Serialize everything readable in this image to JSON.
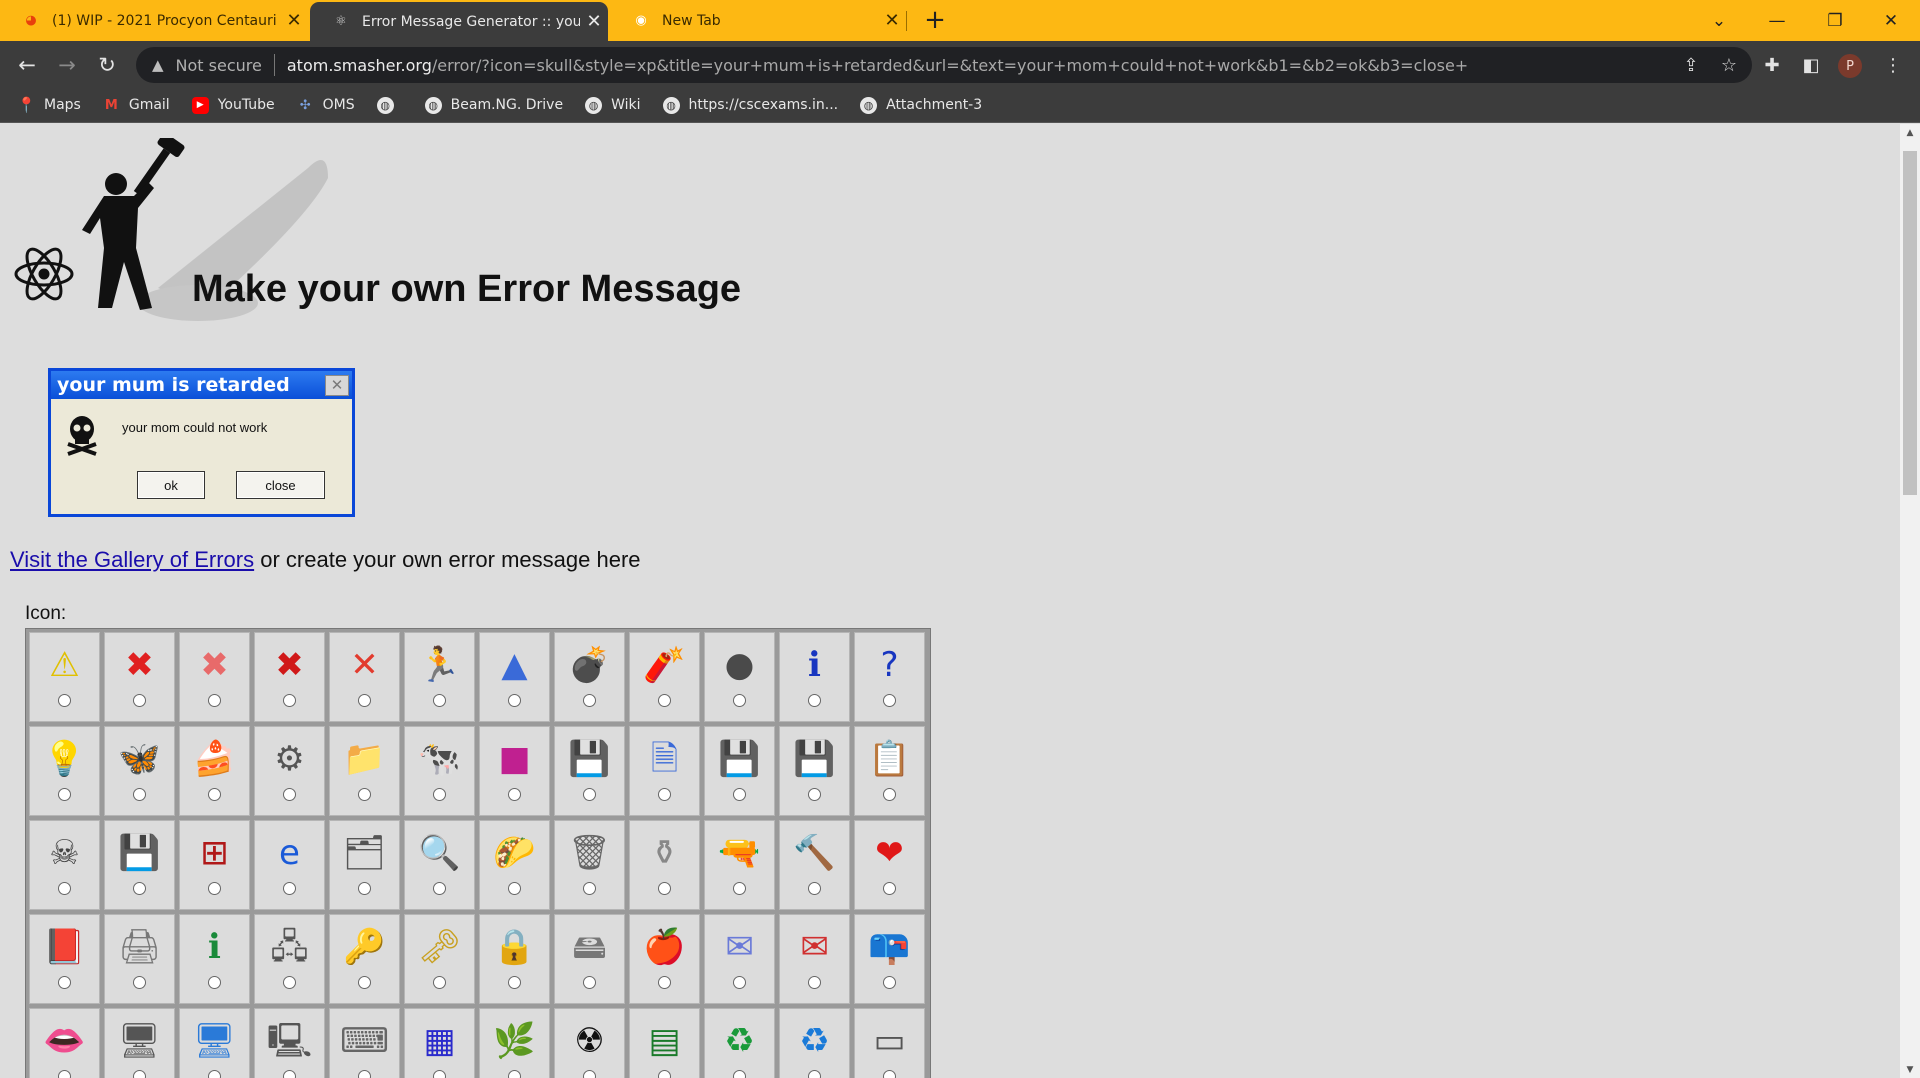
{
  "browser": {
    "tabs": [
      {
        "title": "(1) WIP - 2021 Procyon Centauri",
        "favicon": "reddit-icon",
        "active": false
      },
      {
        "title": "Error Message Generator :: your n",
        "favicon": "atom-smasher-icon",
        "active": true
      },
      {
        "title": "New Tab",
        "favicon": "chrome-icon",
        "active": false
      }
    ],
    "address": {
      "security_label": "Not secure",
      "host": "atom.smasher.org",
      "path": "/error/?icon=skull&style=xp&title=your+mum+is+retarded&url=&text=your+mom+could+not+work&b1=&b2=ok&b3=close+"
    },
    "profile_initial": "P",
    "bookmarks": [
      {
        "label": "Maps",
        "icon": "maps-icon"
      },
      {
        "label": "Gmail",
        "icon": "gmail-icon"
      },
      {
        "label": "YouTube",
        "icon": "youtube-icon"
      },
      {
        "label": "OMS",
        "icon": "oms-icon"
      },
      {
        "label": "",
        "icon": "globe-icon"
      },
      {
        "label": "Beam.NG. Drive",
        "icon": "globe-icon"
      },
      {
        "label": "Wiki",
        "icon": "globe-icon"
      },
      {
        "label": "https://cscexams.in...",
        "icon": "globe-icon"
      },
      {
        "label": "Attachment-3",
        "icon": "globe-icon"
      }
    ]
  },
  "page": {
    "heading": "Make your own Error Message",
    "dialog": {
      "title": "your mum is retarded",
      "text": "your mom could not work",
      "icon": "skull-icon",
      "buttons": [
        "ok",
        "close"
      ]
    },
    "gallery_link": "Visit the Gallery of Errors",
    "gallery_suffix": " or create your own error message here",
    "icon_section_label": "Icon:",
    "icons": [
      {
        "name": "warning-icon",
        "glyph": "⚠",
        "color": "#e0c000"
      },
      {
        "name": "error-red-circle-icon",
        "glyph": "✖",
        "color": "#e02020"
      },
      {
        "name": "error-pink-circle-icon",
        "glyph": "✖",
        "color": "#e86a6a"
      },
      {
        "name": "error-xp-circle-icon",
        "glyph": "✖",
        "color": "#d01818"
      },
      {
        "name": "red-x-icon",
        "glyph": "✕",
        "color": "#e23b2e"
      },
      {
        "name": "running-man-icon",
        "glyph": "🏃",
        "color": "#1e5fd8"
      },
      {
        "name": "blue-triangle-icon",
        "glyph": "▲",
        "color": "#3a6ad8"
      },
      {
        "name": "bomb-icon",
        "glyph": "💣",
        "color": "#333333"
      },
      {
        "name": "dynamite-icon",
        "glyph": "🧨",
        "color": "#c02020"
      },
      {
        "name": "grenade-icon",
        "glyph": "●",
        "color": "#4a4a4a"
      },
      {
        "name": "info-bubble-icon",
        "glyph": "ℹ",
        "color": "#1836c0"
      },
      {
        "name": "question-bubble-icon",
        "glyph": "?",
        "color": "#1836c0"
      },
      {
        "name": "lightbulb-icon",
        "glyph": "💡",
        "color": "#bbbbbb"
      },
      {
        "name": "windows-butterfly-icon",
        "glyph": "🦋",
        "color": "#e87a1a"
      },
      {
        "name": "cake-icon",
        "glyph": "🍰",
        "color": "#d84a8a"
      },
      {
        "name": "robot-dog-icon",
        "glyph": "⚙",
        "color": "#555555"
      },
      {
        "name": "folder-icon",
        "glyph": "📁",
        "color": "#e0c040"
      },
      {
        "name": "cow-icon",
        "glyph": "🐄",
        "color": "#333333"
      },
      {
        "name": "color-cube-icon",
        "glyph": "■",
        "color": "#c02090"
      },
      {
        "name": "floppy-blue-icon",
        "glyph": "💾",
        "color": "#2a2acc"
      },
      {
        "name": "floppy-document-icon",
        "glyph": "🗎",
        "color": "#3a6ad8"
      },
      {
        "name": "floppy-orange-icon",
        "glyph": "💾",
        "color": "#f08a10"
      },
      {
        "name": "floppy-red-icon",
        "glyph": "💾",
        "color": "#cc1818"
      },
      {
        "name": "notepad-icon",
        "glyph": "📋",
        "color": "#c89a6a"
      },
      {
        "name": "floppy-skull-icon",
        "glyph": "☠",
        "color": "#444444"
      },
      {
        "name": "floppy-yellow-icon",
        "glyph": "💾",
        "color": "#f0e020"
      },
      {
        "name": "msdos-icon",
        "glyph": "⊞",
        "color": "#b01818"
      },
      {
        "name": "internet-explorer-icon",
        "glyph": "e",
        "color": "#1a5ad8"
      },
      {
        "name": "files-stack-icon",
        "glyph": "🗂",
        "color": "#555555"
      },
      {
        "name": "magnifier-document-icon",
        "glyph": "🔍",
        "color": "#3a6ad8"
      },
      {
        "name": "taco-icon",
        "glyph": "🌮",
        "color": "#e0b020"
      },
      {
        "name": "trash-can-icon",
        "glyph": "🗑",
        "color": "#666666"
      },
      {
        "name": "urn-icon",
        "glyph": "⚱",
        "color": "#888888"
      },
      {
        "name": "revolver-icon",
        "glyph": "🔫",
        "color": "#555555"
      },
      {
        "name": "hammer-icon",
        "glyph": "🔨",
        "color": "#555555"
      },
      {
        "name": "heart-icon",
        "glyph": "❤",
        "color": "#e01818"
      },
      {
        "name": "purple-book-icon",
        "glyph": "📕",
        "color": "#9a2ab0"
      },
      {
        "name": "scanner-icon",
        "glyph": "🖨",
        "color": "#777777"
      },
      {
        "name": "info-circuit-icon",
        "glyph": "ℹ",
        "color": "#1a8a3a"
      },
      {
        "name": "network-computer-icon",
        "glyph": "🖧",
        "color": "#555555"
      },
      {
        "name": "keys-icon",
        "glyph": "🔑",
        "color": "#c8a020"
      },
      {
        "name": "key-diamond-icon",
        "glyph": "🗝",
        "color": "#c8a020"
      },
      {
        "name": "padlock-icon",
        "glyph": "🔒",
        "color": "#8a6a30"
      },
      {
        "name": "drive-icon",
        "glyph": "🖴",
        "color": "#777777"
      },
      {
        "name": "apple-icon",
        "glyph": "🍎",
        "color": "#3aa0e0"
      },
      {
        "name": "envelope-icon",
        "glyph": "✉",
        "color": "#6a7ad8"
      },
      {
        "name": "envelope-error-icon",
        "glyph": "✉",
        "color": "#d03030"
      },
      {
        "name": "mailbox-icon",
        "glyph": "📪",
        "color": "#555555"
      },
      {
        "name": "lips-icon",
        "glyph": "👄",
        "color": "#d01818"
      },
      {
        "name": "computer-icon",
        "glyph": "🖥",
        "color": "#555555"
      },
      {
        "name": "monitor-icon",
        "glyph": "🖥",
        "color": "#2a7ad8"
      },
      {
        "name": "old-computer-icon",
        "glyph": "🖳",
        "color": "#555555"
      },
      {
        "name": "keyboard-icon",
        "glyph": "⌨",
        "color": "#666666"
      },
      {
        "name": "network-card-icon",
        "glyph": "▦",
        "color": "#2a2acc"
      },
      {
        "name": "cannabis-leaf-icon",
        "glyph": "🌿",
        "color": "#1a9a2a"
      },
      {
        "name": "radiation-icon",
        "glyph": "☢",
        "color": "#111111"
      },
      {
        "name": "memory-stick-icon",
        "glyph": "▤",
        "color": "#1a7a2a"
      },
      {
        "name": "recycle-icon",
        "glyph": "♻",
        "color": "#1a9a3a"
      },
      {
        "name": "recycle-globe-icon",
        "glyph": "♻",
        "color": "#1a7ad8"
      },
      {
        "name": "modem-icon",
        "glyph": "▭",
        "color": "#555555"
      }
    ]
  }
}
